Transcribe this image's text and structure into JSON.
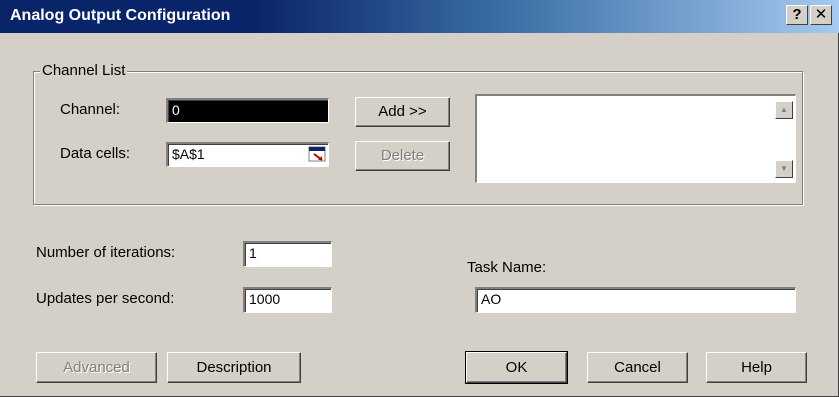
{
  "window": {
    "title": "Analog Output Configuration",
    "help_glyph": "?",
    "close_glyph": "✕"
  },
  "channel_list": {
    "group_label": "Channel List",
    "channel_label": "Channel:",
    "channel_value": "0",
    "data_cells_label": "Data cells:",
    "data_cells_value": "$A$1",
    "add_label": "Add >>",
    "delete_label": "Delete",
    "scroll_up_glyph": "▲",
    "scroll_down_glyph": "▼"
  },
  "settings": {
    "iterations_label": "Number of iterations:",
    "iterations_value": "1",
    "updates_label": "Updates per second:",
    "updates_value": "1000",
    "task_name_label": "Task Name:",
    "task_name_value": "AO"
  },
  "buttons": {
    "advanced": "Advanced",
    "description": "Description",
    "ok": "OK",
    "cancel": "Cancel",
    "help": "Help"
  },
  "colors": {
    "title_bar_start": "#0a246a",
    "title_bar_end": "#a6caf0",
    "dialog_face": "#d4d0c8"
  },
  "icons": {
    "help": "question-mark-icon",
    "close": "close-icon",
    "range_select": "range-select-icon"
  }
}
